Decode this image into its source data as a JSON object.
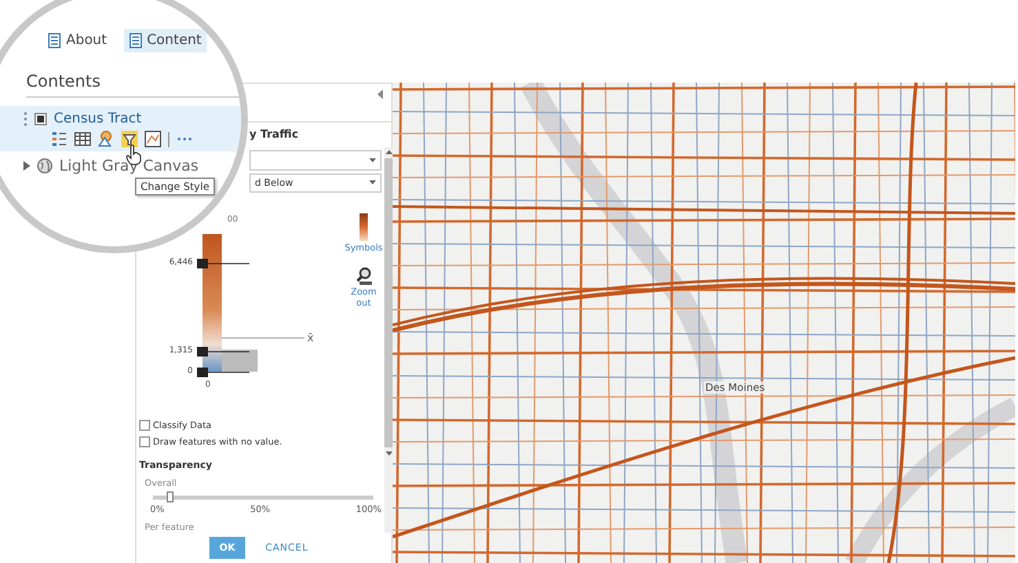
{
  "tabs": [
    {
      "label": "About",
      "selected": false
    },
    {
      "label": "Content",
      "selected": true
    }
  ],
  "contents": {
    "title": "Contents",
    "layers": [
      {
        "kind": "feature",
        "name": "Census Tract",
        "checked": true,
        "selected": true
      },
      {
        "kind": "basemap",
        "name": "Light Gray Canvas",
        "selected": false
      }
    ]
  },
  "tooltip": "Change Style",
  "style_panel": {
    "title": "y Traffic",
    "dropdown_value": "d Below",
    "histogram": {
      "top_label": "00",
      "axis_label": "0",
      "mean_symbol": "x̄",
      "handles": [
        {
          "label": "6,446",
          "level": 0.76
        },
        {
          "label": "1,315",
          "level": 0.15
        },
        {
          "label": "0",
          "level": 0
        }
      ]
    },
    "symbols_label": "Symbols",
    "zoom_label": "Zoom out",
    "options": [
      {
        "label": "Classify Data",
        "checked": false
      },
      {
        "label": "Draw features with no value.",
        "checked": false
      }
    ],
    "transparency": {
      "title": "Transparency",
      "overall_label": "Overall",
      "level": 0.08,
      "ticks": [
        "0%",
        "50%",
        "100%"
      ],
      "per_feature_label": "Per feature"
    },
    "buttons": [
      {
        "label": "OK",
        "kind": "primary"
      },
      {
        "label": "CANCEL",
        "kind": "link"
      }
    ]
  },
  "map": {
    "place_label": "Des Moines"
  }
}
